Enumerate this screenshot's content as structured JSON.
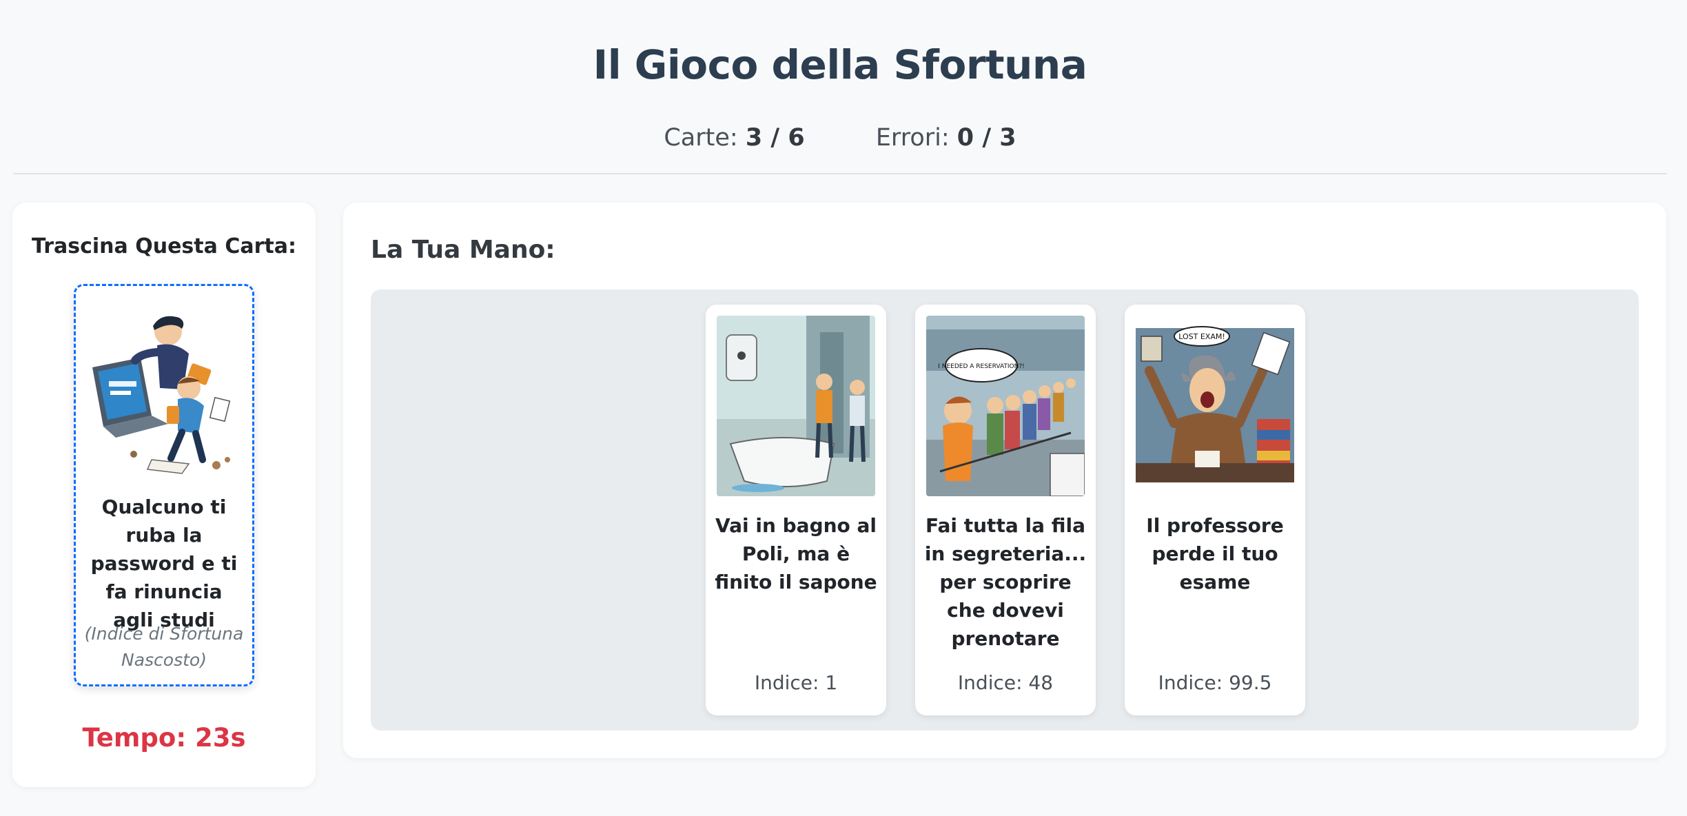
{
  "header": {
    "title": "Il Gioco della Sfortuna",
    "cards_label": "Carte:",
    "cards_value": "3 / 6",
    "errors_label": "Errori:",
    "errors_value": "0 / 3"
  },
  "draw_panel": {
    "title": "Trascina Questa Carta:",
    "card": {
      "image": "hacker-stealing-password-illustration",
      "text": "Qualcuno ti ruba la password e ti fa rinuncia agli studi",
      "hidden_index_label": "(Indice di Sfortuna Nascosto)"
    },
    "timer": "Tempo: 23s"
  },
  "hand": {
    "title": "La Tua Mano:",
    "cards": [
      {
        "image": "bathroom-no-soap-illustration",
        "text": "Vai in bagno al Poli, ma è finito il sapone",
        "index": "Indice: 1"
      },
      {
        "image": "queue-at-office-illustration",
        "text": "Fai tutta la fila in segreteria... per scoprire che dovevi prenotare",
        "index": "Indice: 48",
        "speech_bubble": "I NEEDED A RESERVATION?!"
      },
      {
        "image": "professor-lost-exam-illustration",
        "text": "Il professore perde il tuo esame",
        "index": "Indice: 99.5",
        "speech_bubble": "LOST EXAM!"
      }
    ]
  },
  "colors": {
    "accent": "#0d6efd",
    "timer": "#dc3545",
    "title": "#2c3e50",
    "hand_bg": "#e9ecef"
  }
}
